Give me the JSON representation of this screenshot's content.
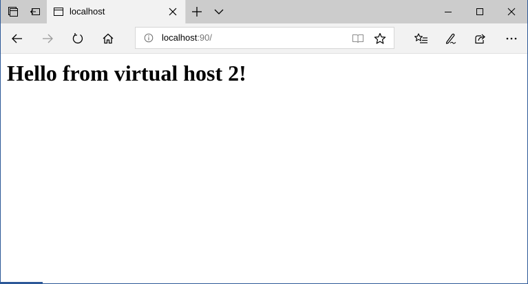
{
  "browser": {
    "tab": {
      "title": "localhost"
    },
    "address": {
      "host": "localhost",
      "port_path": ":90/"
    },
    "icons": {
      "tab_actions": "tab-actions-icon",
      "set_aside": "set-aside-tabs-icon",
      "tab_page": "page-icon",
      "tab_close": "close-icon",
      "new_tab": "plus-icon",
      "tab_preview": "chevron-down-icon",
      "minimize": "minimize-icon",
      "maximize": "maximize-icon",
      "close_window": "close-icon",
      "back": "arrow-left-icon",
      "forward": "arrow-right-icon",
      "refresh": "refresh-icon",
      "home": "home-icon",
      "site_info": "info-icon",
      "reading_view": "book-icon",
      "favorite": "star-icon",
      "favorites_hub": "favorites-list-icon",
      "web_note": "pen-icon",
      "share": "share-icon",
      "more": "ellipsis-icon"
    },
    "colors": {
      "frame_border": "#2b5797",
      "titlebar": "#cccccc",
      "toolbar": "#f2f2f2"
    }
  },
  "page": {
    "heading": "Hello from virtual host 2!"
  }
}
